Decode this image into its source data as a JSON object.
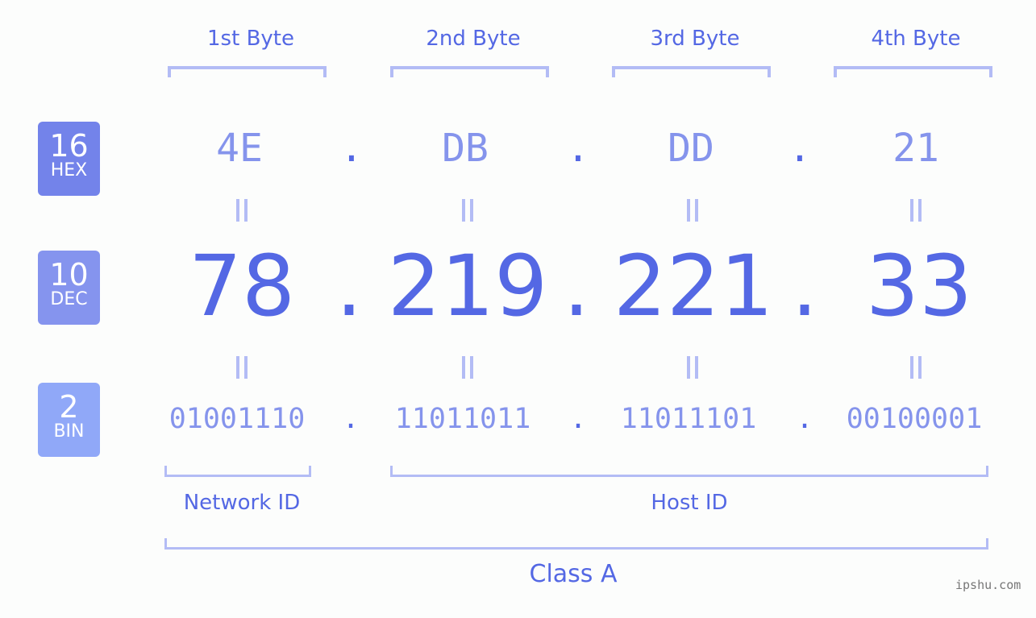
{
  "header": {
    "bytes": [
      "1st Byte",
      "2nd Byte",
      "3rd Byte",
      "4th Byte"
    ]
  },
  "badges": {
    "hex": {
      "num": "16",
      "label": "HEX",
      "color": "#7383ea"
    },
    "dec": {
      "num": "10",
      "label": "DEC",
      "color": "#8594ee"
    },
    "bin": {
      "num": "2",
      "label": "BIN",
      "color": "#90a8f8"
    }
  },
  "address": {
    "hex": [
      "4E",
      "DB",
      "DD",
      "21"
    ],
    "dec": [
      "78",
      "219",
      "221",
      "33"
    ],
    "bin": [
      "01001110",
      "11011011",
      "11011101",
      "00100001"
    ],
    "separator": "."
  },
  "segments": {
    "network_id": "Network ID",
    "host_id": "Host ID",
    "class": "Class A"
  },
  "colors": {
    "accent": "#5468e4",
    "light": "#8594ec",
    "bracket": "#b3bcf5"
  },
  "watermark": "ipshu.com"
}
